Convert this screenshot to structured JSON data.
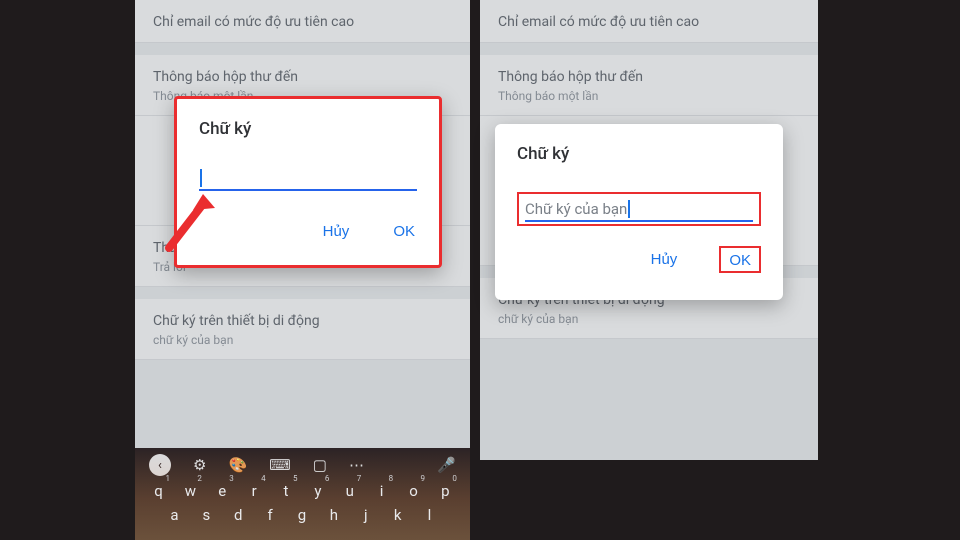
{
  "settings": {
    "item1_title": "Chỉ email có mức độ ưu tiên cao",
    "item2_title": "Thông báo hộp thư đến",
    "item2_sub": "Thông báo một lần",
    "item3_title_left": "Thao tác trả lời mặc định",
    "item3_sub_left": "Trả lời",
    "item4_title": "Chữ ký trên thiết bị di động",
    "item4_sub": "chữ ký của bạn"
  },
  "dialog": {
    "title": "Chữ ký",
    "cancel": "Hủy",
    "ok": "OK",
    "input_empty": "",
    "input_filled": "Chữ ký của bạn"
  },
  "keyboard": {
    "row1": [
      "q",
      "w",
      "e",
      "r",
      "t",
      "y",
      "u",
      "i",
      "o",
      "p"
    ],
    "row1_sup": [
      "1",
      "2",
      "3",
      "4",
      "5",
      "6",
      "7",
      "8",
      "9",
      "0"
    ],
    "row2": [
      "a",
      "s",
      "d",
      "f",
      "g",
      "h",
      "j",
      "k",
      "l"
    ]
  }
}
